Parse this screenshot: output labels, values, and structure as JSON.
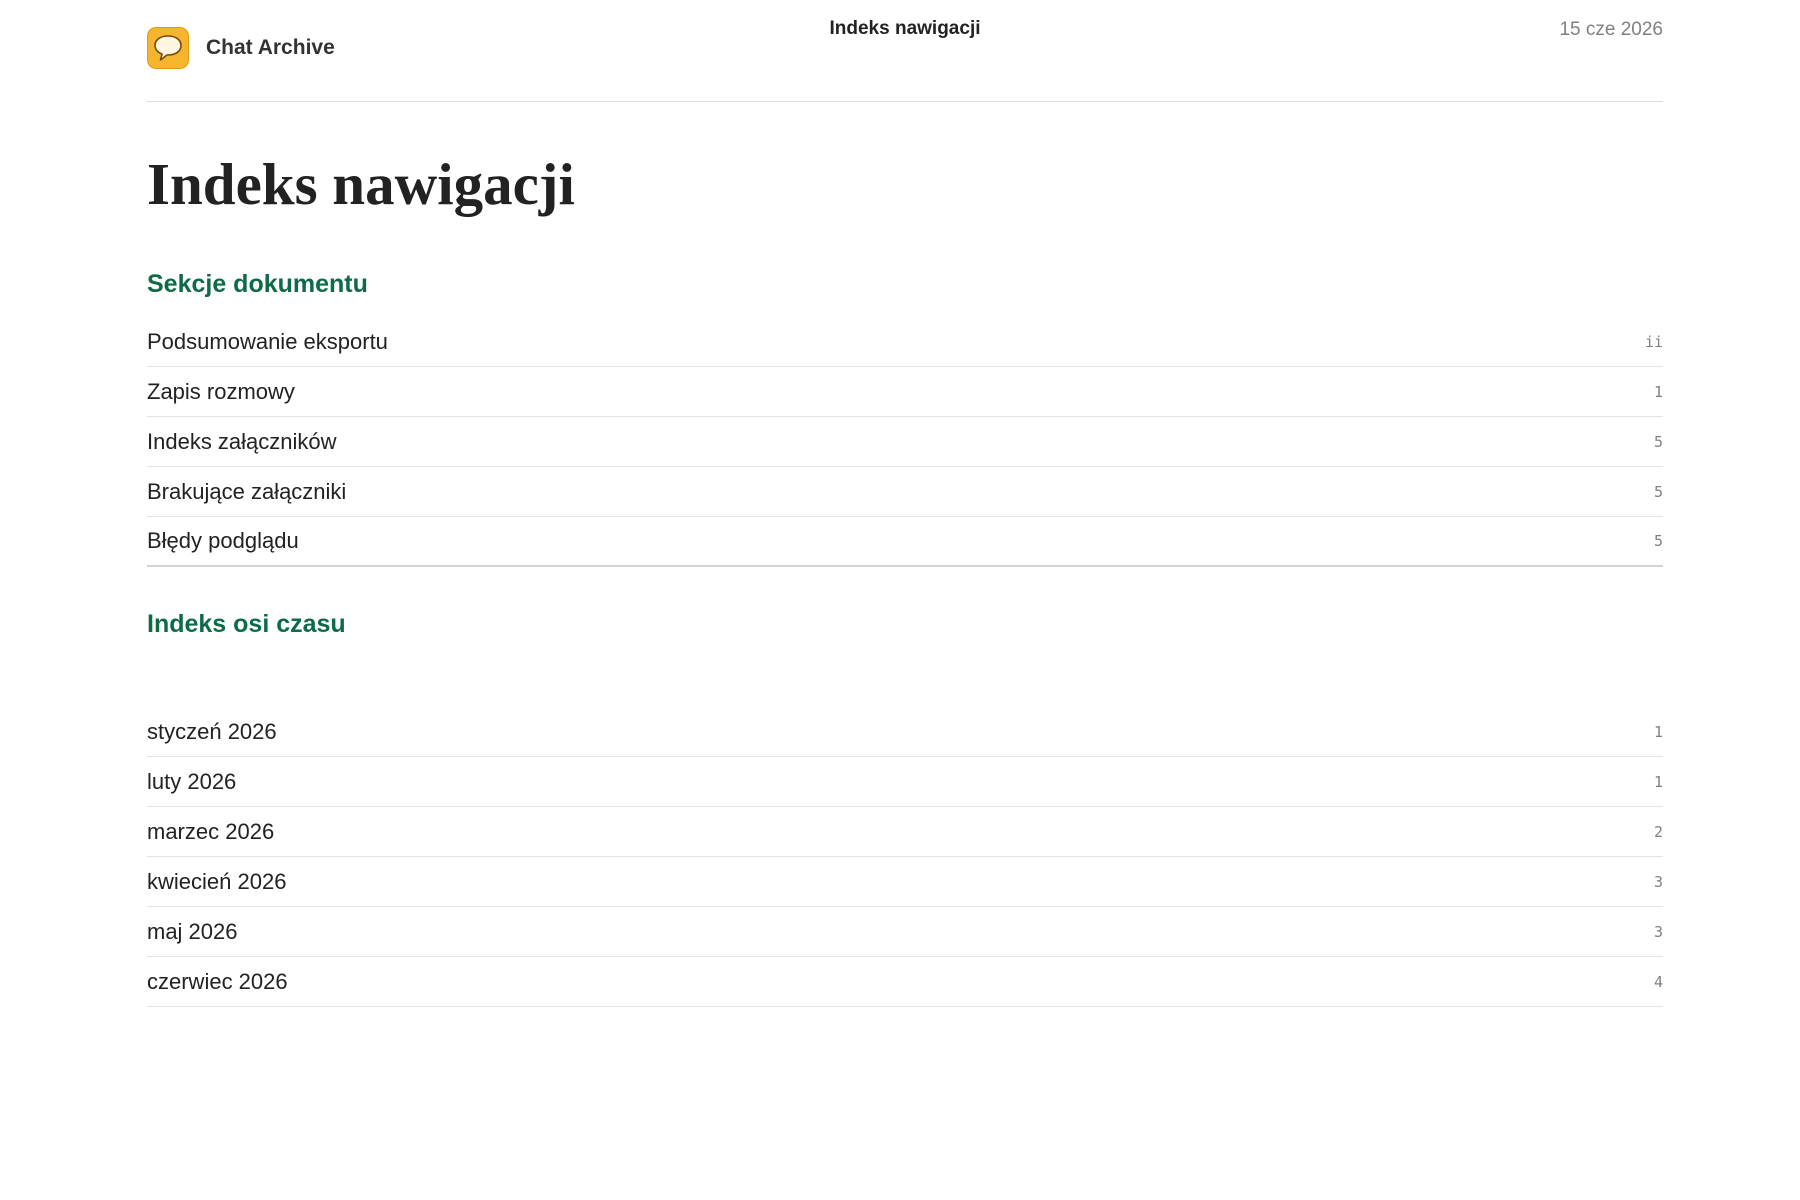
{
  "header": {
    "app_name": "Chat Archive",
    "title": "Indeks nawigacji",
    "date": "15 cze 2026",
    "icon": "chat-bubble-icon"
  },
  "main": {
    "title": "Indeks nawigacji",
    "sections_heading": "Sekcje dokumentu",
    "sections": [
      {
        "label": "Podsumowanie eksportu",
        "page": "ii"
      },
      {
        "label": "Zapis rozmowy",
        "page": "1"
      },
      {
        "label": "Indeks załączników",
        "page": "5"
      },
      {
        "label": "Brakujące załączniki",
        "page": "5"
      },
      {
        "label": "Błędy podglądu",
        "page": "5"
      }
    ],
    "timeline_heading": "Indeks osi czasu",
    "timeline": [
      {
        "label": "styczeń 2026",
        "page": "1"
      },
      {
        "label": "luty 2026",
        "page": "1"
      },
      {
        "label": "marzec 2026",
        "page": "2"
      },
      {
        "label": "kwiecień 2026",
        "page": "3"
      },
      {
        "label": "maj 2026",
        "page": "3"
      },
      {
        "label": "czerwiec 2026",
        "page": "4"
      }
    ]
  },
  "colors": {
    "accent_green": "#0d6b46",
    "icon_orange": "#f6b52e"
  }
}
